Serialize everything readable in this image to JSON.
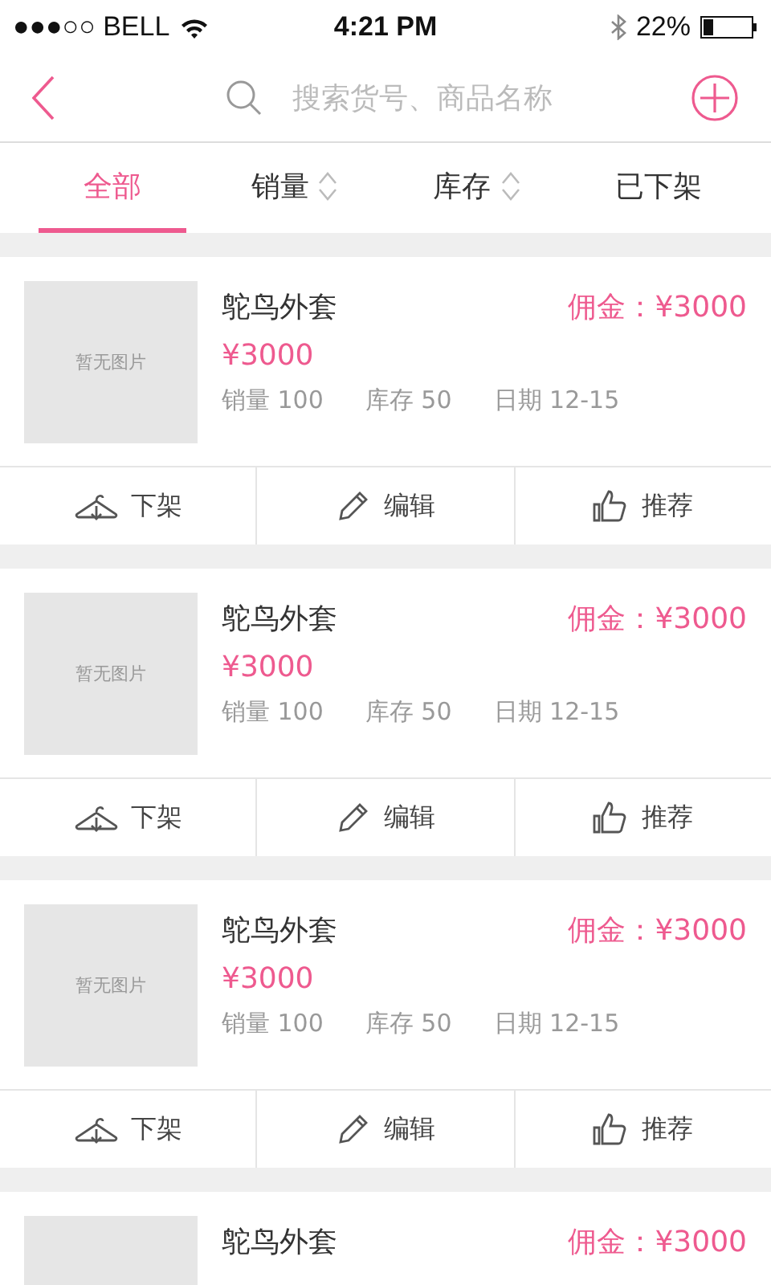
{
  "status_bar": {
    "carrier": "●●●○○ BELL",
    "time": "4:21 PM",
    "battery": "22%"
  },
  "search": {
    "placeholder": "搜索货号、商品名称"
  },
  "tabs": [
    {
      "label": "全部",
      "selected": true,
      "kind": "plain"
    },
    {
      "label": "销量",
      "selected": false,
      "kind": "sort"
    },
    {
      "label": "库存",
      "selected": false,
      "kind": "sort"
    },
    {
      "label": "已下架",
      "selected": false,
      "kind": "plain"
    }
  ],
  "products": [
    {
      "image_text": "暂无图片",
      "name": "鸵鸟外套",
      "commission": "佣金：¥3000",
      "price": "¥3000",
      "stats": [
        "销量 100",
        "库存 50",
        "日期 12-15"
      ],
      "actions": [
        {
          "kind": "unshelve",
          "label": "下架"
        },
        {
          "kind": "edit",
          "label": "编辑"
        },
        {
          "kind": "recommend",
          "label": "推荐"
        }
      ]
    },
    {
      "image_text": "暂无图片",
      "name": "鸵鸟外套",
      "commission": "佣金：¥3000",
      "price": "¥3000",
      "stats": [
        "销量 100",
        "库存 50",
        "日期 12-15"
      ],
      "actions": [
        {
          "kind": "unshelve",
          "label": "下架"
        },
        {
          "kind": "edit",
          "label": "编辑"
        },
        {
          "kind": "recommend",
          "label": "推荐"
        }
      ]
    },
    {
      "image_text": "暂无图片",
      "name": "鸵鸟外套",
      "commission": "佣金：¥3000",
      "price": "¥3000",
      "stats": [
        "销量 100",
        "库存 50",
        "日期 12-15"
      ],
      "actions": [
        {
          "kind": "unshelve",
          "label": "下架"
        },
        {
          "kind": "edit",
          "label": "编辑"
        },
        {
          "kind": "recommend",
          "label": "推荐"
        }
      ]
    },
    {
      "name": "鸵鸟外套",
      "commission": "佣金：¥3000"
    }
  ]
}
